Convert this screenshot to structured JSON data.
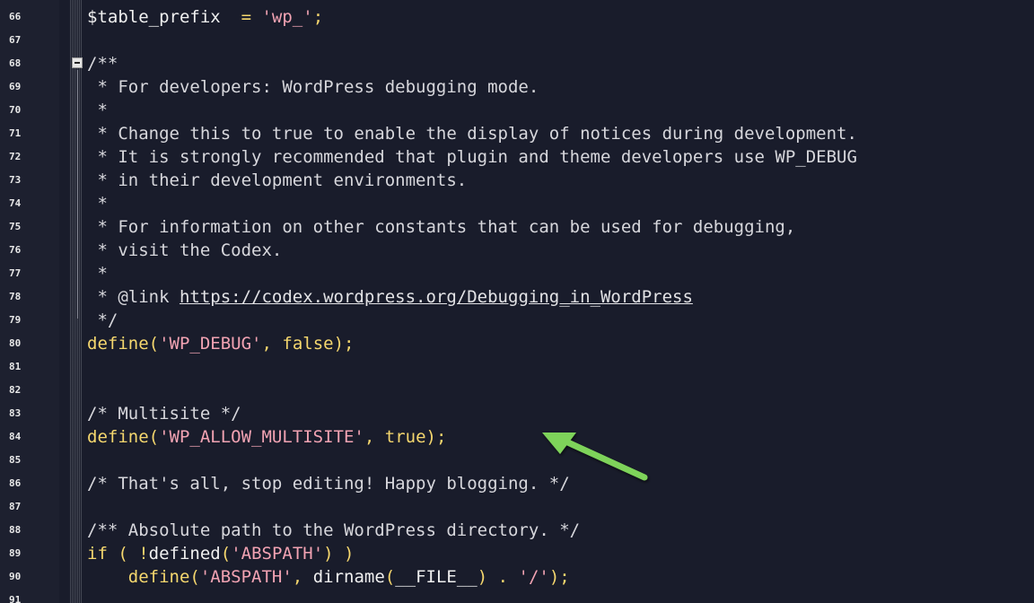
{
  "editor": {
    "lines": [
      {
        "num": "66",
        "parts": [
          {
            "t": "$table_prefix",
            "c": "var"
          },
          {
            "t": "  = ",
            "c": "op"
          },
          {
            "t": "'wp_'",
            "c": "str"
          },
          {
            "t": ";",
            "c": "op"
          }
        ]
      },
      {
        "num": "67",
        "parts": []
      },
      {
        "num": "68",
        "parts": [
          {
            "t": "/**",
            "c": "cmt"
          }
        ]
      },
      {
        "num": "69",
        "parts": [
          {
            "t": " * For developers: WordPress debugging mode.",
            "c": "cmt"
          }
        ]
      },
      {
        "num": "70",
        "parts": [
          {
            "t": " *",
            "c": "cmt"
          }
        ]
      },
      {
        "num": "71",
        "parts": [
          {
            "t": " * Change this to true to enable the display of notices during development.",
            "c": "cmt"
          }
        ]
      },
      {
        "num": "72",
        "parts": [
          {
            "t": " * It is strongly recommended that plugin and theme developers use WP_DEBUG",
            "c": "cmt"
          }
        ]
      },
      {
        "num": "73",
        "parts": [
          {
            "t": " * in their development environments.",
            "c": "cmt"
          }
        ]
      },
      {
        "num": "74",
        "parts": [
          {
            "t": " *",
            "c": "cmt"
          }
        ]
      },
      {
        "num": "75",
        "parts": [
          {
            "t": " * For information on other constants that can be used for debugging,",
            "c": "cmt"
          }
        ]
      },
      {
        "num": "76",
        "parts": [
          {
            "t": " * visit the Codex.",
            "c": "cmt"
          }
        ]
      },
      {
        "num": "77",
        "parts": [
          {
            "t": " *",
            "c": "cmt"
          }
        ]
      },
      {
        "num": "78",
        "parts": [
          {
            "t": " * @link ",
            "c": "cmt"
          },
          {
            "t": "https://codex.wordpress.org/Debugging_in_WordPress",
            "c": "link"
          }
        ]
      },
      {
        "num": "79",
        "parts": [
          {
            "t": " */",
            "c": "cmt"
          }
        ]
      },
      {
        "num": "80",
        "parts": [
          {
            "t": "define",
            "c": "kw"
          },
          {
            "t": "(",
            "c": "op"
          },
          {
            "t": "'WP_DEBUG'",
            "c": "str"
          },
          {
            "t": ", ",
            "c": "op"
          },
          {
            "t": "false",
            "c": "kw"
          },
          {
            "t": ");",
            "c": "op"
          }
        ]
      },
      {
        "num": "81",
        "parts": []
      },
      {
        "num": "82",
        "parts": []
      },
      {
        "num": "83",
        "parts": [
          {
            "t": "/* Multisite */",
            "c": "cmt"
          }
        ]
      },
      {
        "num": "84",
        "parts": [
          {
            "t": "define",
            "c": "kw"
          },
          {
            "t": "(",
            "c": "op"
          },
          {
            "t": "'WP_ALLOW_MULTISITE'",
            "c": "str"
          },
          {
            "t": ", ",
            "c": "op"
          },
          {
            "t": "true",
            "c": "kw"
          },
          {
            "t": ");",
            "c": "op"
          }
        ]
      },
      {
        "num": "85",
        "parts": []
      },
      {
        "num": "86",
        "parts": [
          {
            "t": "/* That's all, stop editing! Happy blogging. */",
            "c": "cmt"
          }
        ]
      },
      {
        "num": "87",
        "parts": []
      },
      {
        "num": "88",
        "parts": [
          {
            "t": "/** Absolute path to the WordPress directory. */",
            "c": "cmt"
          }
        ]
      },
      {
        "num": "89",
        "parts": [
          {
            "t": "if",
            "c": "kw"
          },
          {
            "t": " ( !",
            "c": "op"
          },
          {
            "t": "defined",
            "c": "plain"
          },
          {
            "t": "(",
            "c": "op"
          },
          {
            "t": "'ABSPATH'",
            "c": "str"
          },
          {
            "t": ") )",
            "c": "op"
          }
        ]
      },
      {
        "num": "90",
        "parts": [
          {
            "t": "    define",
            "c": "kw"
          },
          {
            "t": "(",
            "c": "op"
          },
          {
            "t": "'ABSPATH'",
            "c": "str"
          },
          {
            "t": ", ",
            "c": "op"
          },
          {
            "t": "dirname",
            "c": "plain"
          },
          {
            "t": "(",
            "c": "op"
          },
          {
            "t": "__FILE__",
            "c": "plain"
          },
          {
            "t": ") . ",
            "c": "op"
          },
          {
            "t": "'/'",
            "c": "str"
          },
          {
            "t": ");",
            "c": "op"
          }
        ]
      },
      {
        "num": "91",
        "parts": []
      }
    ]
  },
  "annotation": {
    "arrow_color": "#7ed35a",
    "icon": "arrow-pointer-icon"
  }
}
